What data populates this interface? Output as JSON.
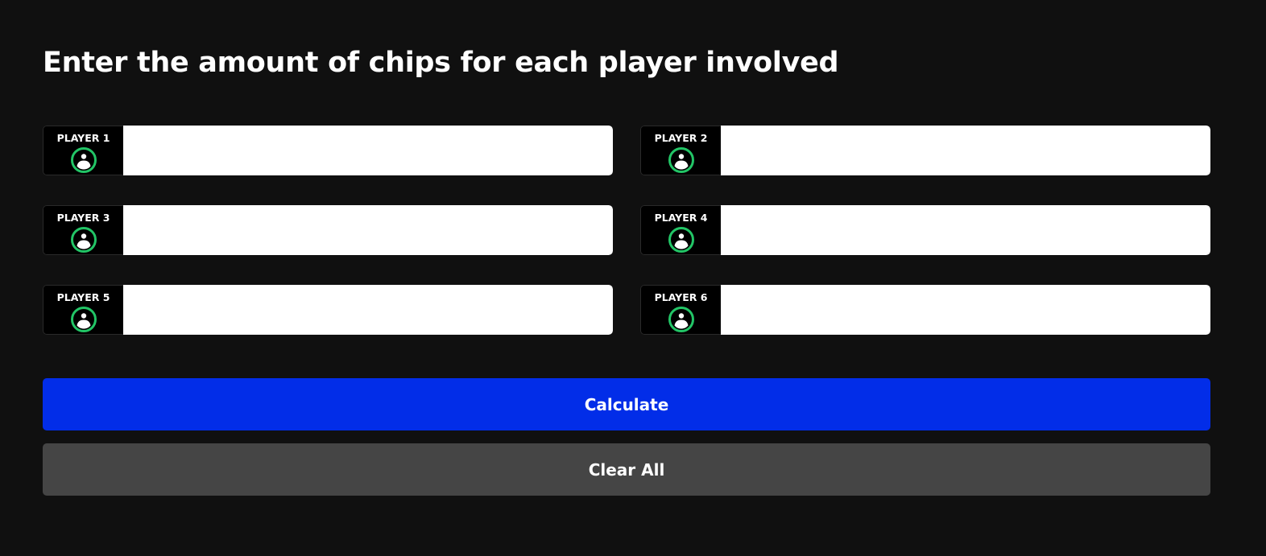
{
  "page": {
    "title": "Enter the amount of chips for each player involved"
  },
  "players": [
    {
      "label": "PLAYER 1",
      "value": "",
      "icon": "player-avatar-icon"
    },
    {
      "label": "PLAYER 2",
      "value": "",
      "icon": "player-avatar-icon"
    },
    {
      "label": "PLAYER 3",
      "value": "",
      "icon": "player-avatar-icon"
    },
    {
      "label": "PLAYER 4",
      "value": "",
      "icon": "player-avatar-icon"
    },
    {
      "label": "PLAYER 5",
      "value": "",
      "icon": "player-avatar-icon"
    },
    {
      "label": "PLAYER 6",
      "value": "",
      "icon": "player-avatar-icon"
    }
  ],
  "actions": {
    "calculate_label": "Calculate",
    "clear_label": "Clear All"
  },
  "colors": {
    "background": "#101010",
    "primary_button": "#022de8",
    "secondary_button": "#454545",
    "avatar_ring": "#22c566"
  }
}
